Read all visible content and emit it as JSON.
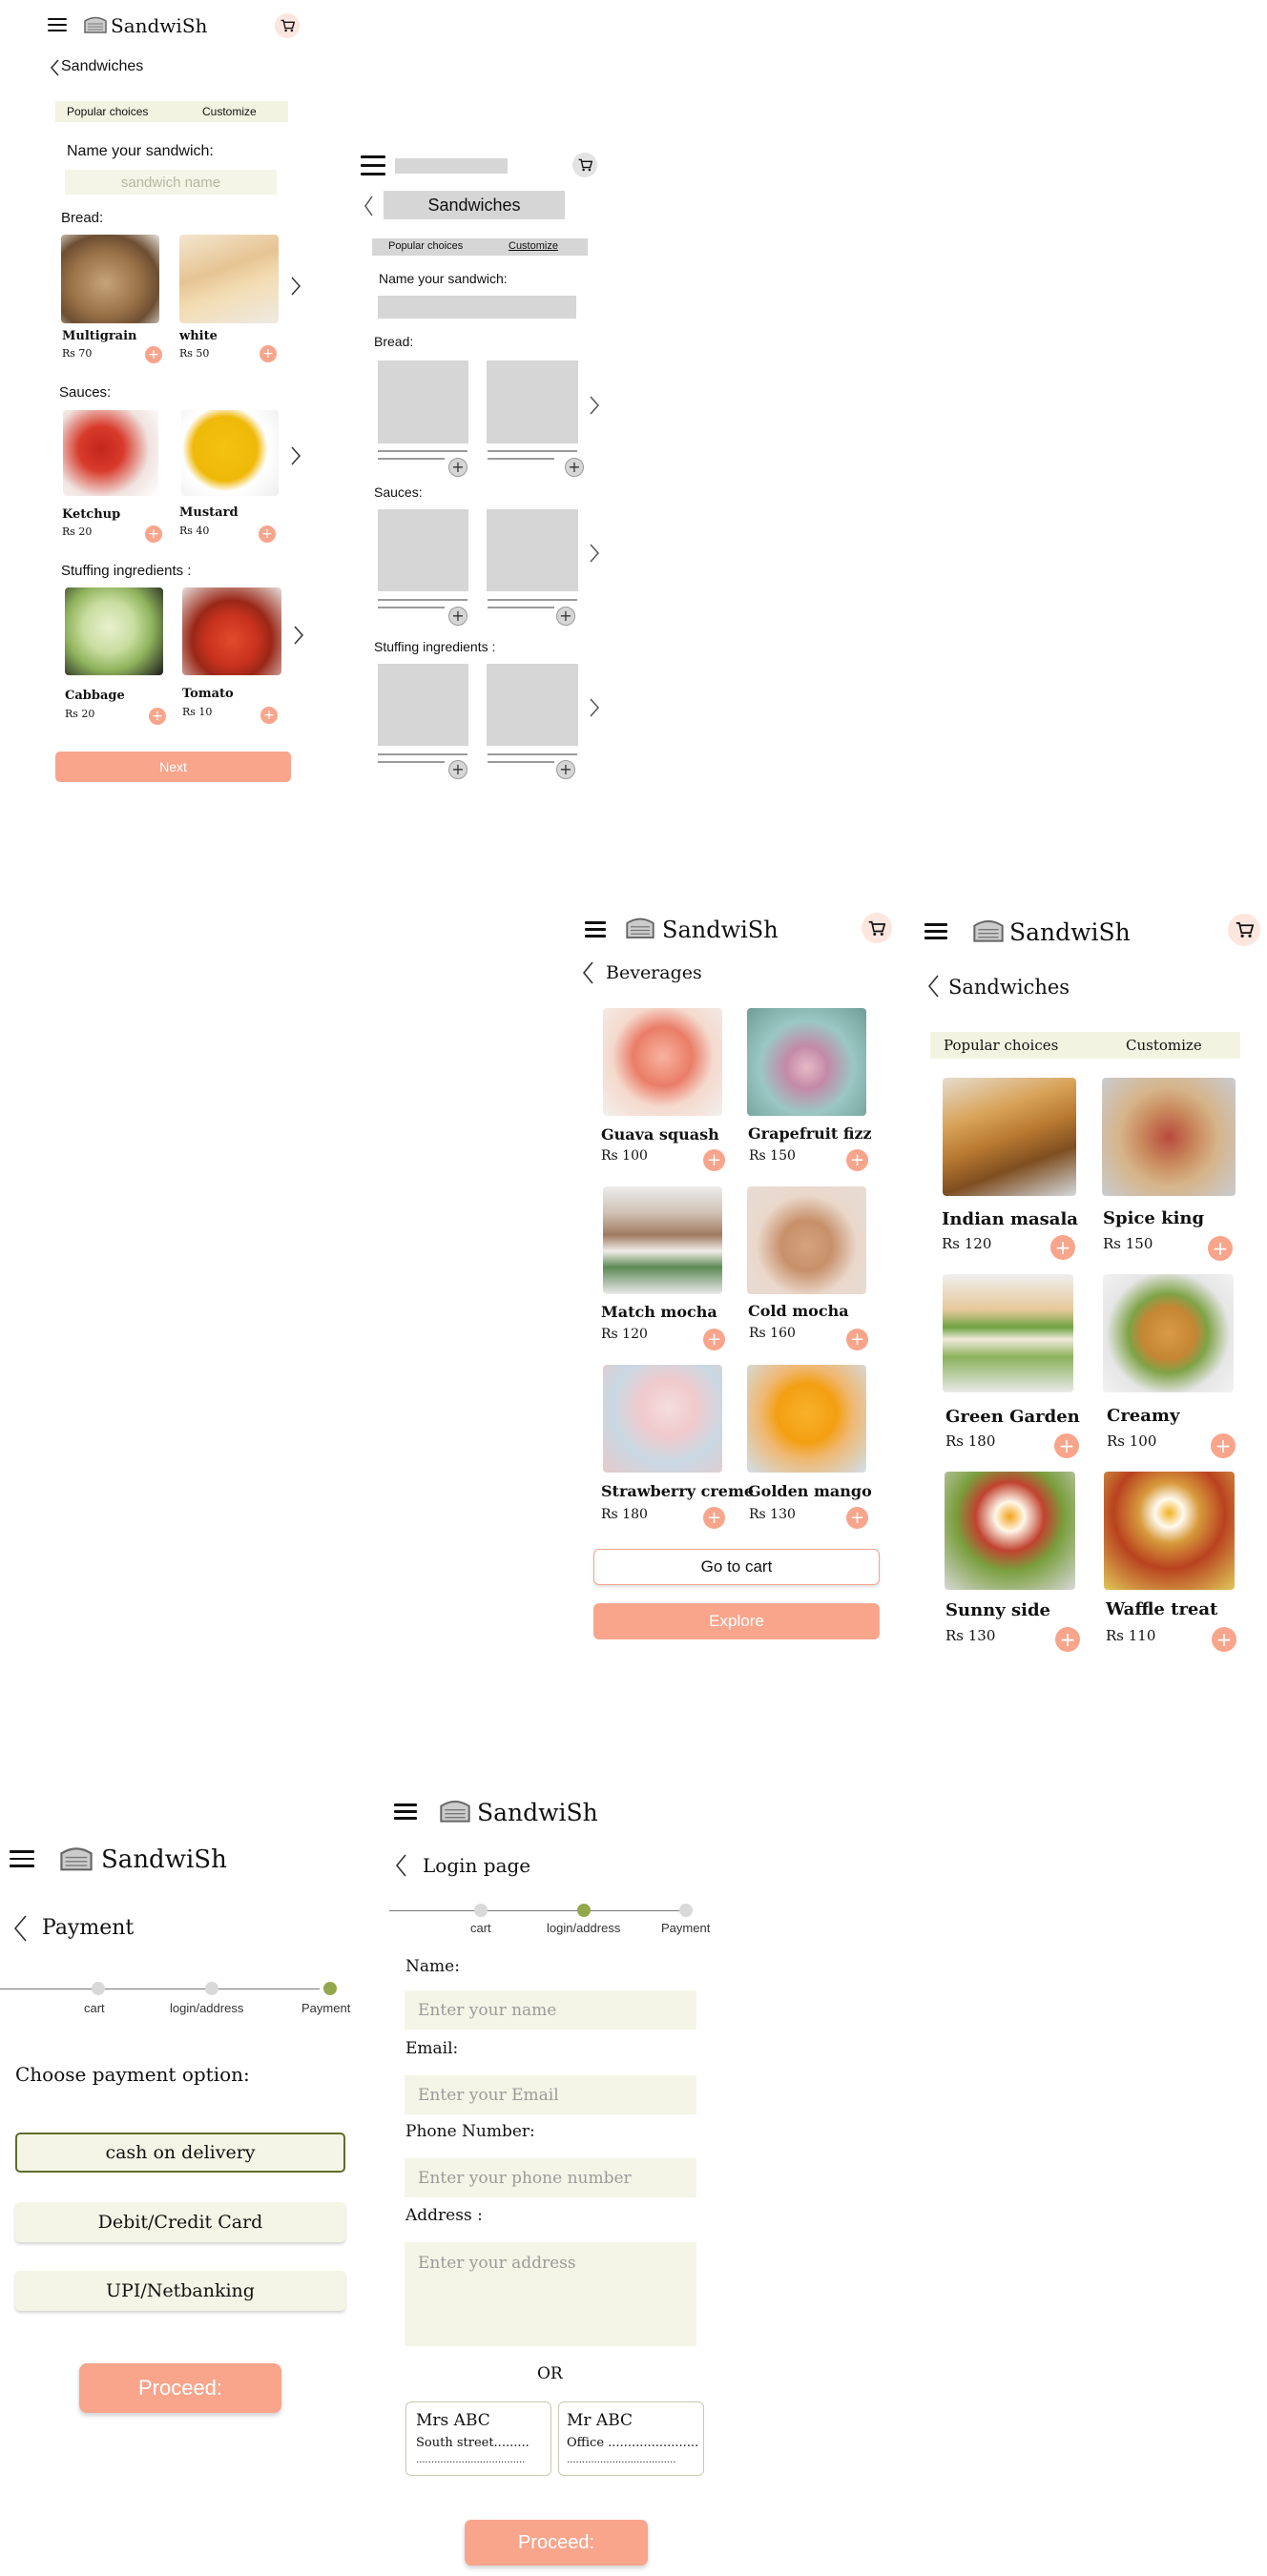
{
  "brand": "SandwiSh",
  "screen1": {
    "back_label": "Sandwiches",
    "tabs": [
      "Popular choices",
      "Customize"
    ],
    "name_label": "Name your sandwich:",
    "name_placeholder": "sandwich name",
    "bread_label": "Bread:",
    "sauces_label": "Sauces:",
    "stuffing_label": "Stuffing ingredients :",
    "bread": [
      {
        "name": "Multigrain",
        "price": "Rs 70"
      },
      {
        "name": "white",
        "price": "Rs 50"
      }
    ],
    "sauces": [
      {
        "name": "Ketchup",
        "price": "Rs 20"
      },
      {
        "name": "Mustard",
        "price": "Rs 40"
      }
    ],
    "stuffing": [
      {
        "name": "Cabbage",
        "price": "Rs 20"
      },
      {
        "name": "Tomato",
        "price": "Rs 10"
      }
    ],
    "next_label": "Next"
  },
  "wireframe": {
    "back_label": "Sandwiches",
    "tabs": [
      "Popular choices",
      "Customize"
    ],
    "name_label": "Name your sandwich:",
    "bread_label": "Bread:",
    "sauces_label": "Sauces:",
    "stuffing_label": "Stuffing ingredients :"
  },
  "beverages": {
    "back_label": "Beverages",
    "items": [
      {
        "name": "Guava squash",
        "price": "Rs 100"
      },
      {
        "name": "Grapefruit fizz",
        "price": "Rs 150"
      },
      {
        "name": "Match mocha",
        "price": "Rs 120"
      },
      {
        "name": "Cold mocha",
        "price": "Rs 160"
      },
      {
        "name": "Strawberry creme",
        "price": "Rs 180"
      },
      {
        "name": "Golden mango",
        "price": "Rs 130"
      }
    ],
    "go_to_cart_label": "Go to cart",
    "explore_label": "Explore"
  },
  "sandwiches": {
    "back_label": "Sandwiches",
    "tabs": [
      "Popular choices",
      "Customize"
    ],
    "items": [
      {
        "name": "Indian masala",
        "price": "Rs 120"
      },
      {
        "name": "Spice king",
        "price": "Rs 150"
      },
      {
        "name": "Green Garden",
        "price": "Rs 180"
      },
      {
        "name": "Creamy",
        "price": "Rs 100"
      },
      {
        "name": "Sunny side",
        "price": "Rs 130"
      },
      {
        "name": "Waffle treat",
        "price": "Rs 110"
      }
    ]
  },
  "payment": {
    "back_label": "Payment",
    "steps": [
      "cart",
      "login/address",
      "Payment"
    ],
    "choose_label": "Choose payment option:",
    "options": [
      "cash on delivery",
      "Debit/Credit Card",
      "UPI/Netbanking"
    ],
    "proceed_label": "Proceed:"
  },
  "login": {
    "back_label": "Login page",
    "steps": [
      "cart",
      "login/address",
      "Payment"
    ],
    "name_label": "Name:",
    "name_placeholder": "Enter your name",
    "email_label": "Email:",
    "email_placeholder": "Enter your Email",
    "phone_label": "Phone Number:",
    "phone_placeholder": "Enter your phone number",
    "address_label": "Address :",
    "address_placeholder": "Enter your address",
    "or_label": "OR",
    "saved": [
      {
        "name": "Mrs ABC",
        "line": "South street.........",
        "dots": "...................................."
      },
      {
        "name": "Mr ABC",
        "line": "Office .......................",
        "dots": "...................................."
      }
    ],
    "proceed_label": "Proceed:"
  },
  "colors": {
    "accent": "#f8a58c",
    "field": "#f4f5e6",
    "tab": "#f2f4e1",
    "step_active": "#93a84c",
    "selected_border": "#5f6d2a"
  }
}
